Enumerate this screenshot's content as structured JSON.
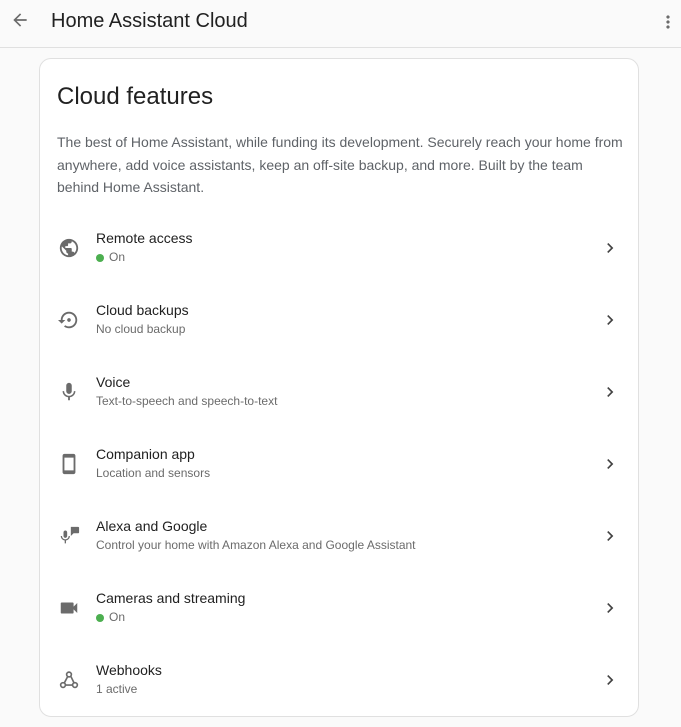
{
  "header": {
    "title": "Home Assistant Cloud"
  },
  "card": {
    "title": "Cloud features",
    "description": "The best of Home Assistant, while funding its development. Securely reach your home from anywhere, add voice assistants, keep an off-site backup, and more. Built by the team behind Home Assistant."
  },
  "colors": {
    "status_on": "#4caf50",
    "icon": "#6b6b6b"
  },
  "features": [
    {
      "label": "Remote access",
      "sub": "On",
      "status": "on",
      "icon": "globe-icon"
    },
    {
      "label": "Cloud backups",
      "sub": "No cloud backup",
      "icon": "backup-restore-icon"
    },
    {
      "label": "Voice",
      "sub": "Text-to-speech and speech-to-text",
      "icon": "microphone-icon"
    },
    {
      "label": "Companion app",
      "sub": "Location and sensors",
      "icon": "cellphone-icon"
    },
    {
      "label": "Alexa and Google",
      "sub": "Control your home with Amazon Alexa and Google Assistant",
      "icon": "voice-message-icon"
    },
    {
      "label": "Cameras and streaming",
      "sub": "On",
      "status": "on",
      "icon": "video-camera-icon"
    },
    {
      "label": "Webhooks",
      "sub": "1 active",
      "icon": "webhook-icon"
    }
  ]
}
